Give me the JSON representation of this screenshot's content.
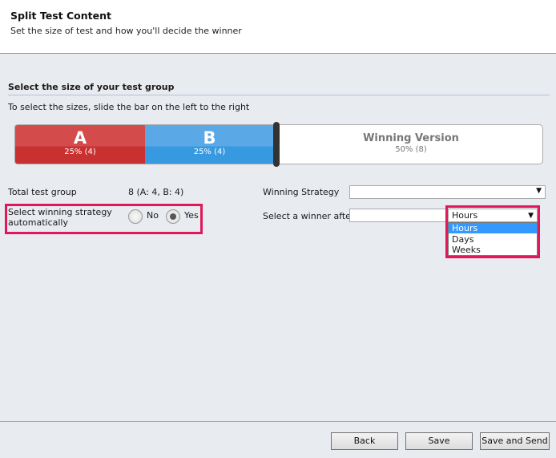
{
  "header": {
    "title": "Split Test Content",
    "subtitle": "Set the size of test and how you'll decide the winner"
  },
  "section": {
    "title": "Select the size of your test group",
    "instruction": "To select the sizes, slide the bar on the left to the right"
  },
  "slider": {
    "a": {
      "label": "A",
      "value": "25% (4)",
      "percent": 25,
      "color": "#d03a3a"
    },
    "b": {
      "label": "B",
      "value": "25% (4)",
      "percent": 25,
      "color": "#3d9ee3"
    },
    "winning": {
      "label": "Winning Version",
      "value": "50% (8)",
      "percent": 50
    }
  },
  "form": {
    "total_label": "Total test group",
    "total_value": "8 (A: 4, B: 4)",
    "auto_label": "Select winning strategy automatically",
    "radio_no": "No",
    "radio_yes": "Yes",
    "auto_selected": "Yes",
    "strategy_label": "Winning Strategy",
    "strategy_value": "",
    "winner_after_label": "Select a winner after",
    "winner_after_value": "",
    "unit_selected": "Hours",
    "unit_options": [
      "Hours",
      "Days",
      "Weeks"
    ]
  },
  "footer": {
    "back": "Back",
    "save": "Save",
    "save_send": "Save and Send"
  },
  "colors": {
    "highlight": "#e0185a",
    "selected_option": "#3399ff"
  }
}
